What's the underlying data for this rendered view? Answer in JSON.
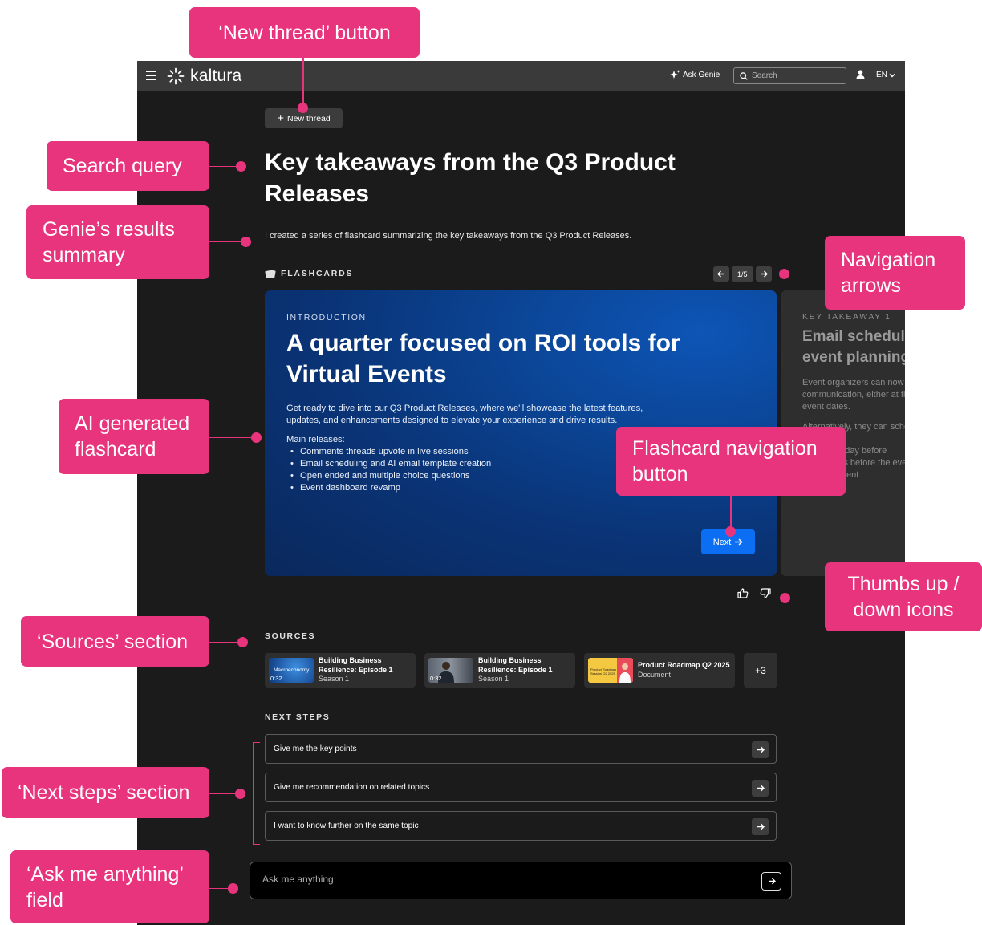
{
  "header": {
    "logo_text": "kaltura",
    "ask_genie_label": "Ask Genie",
    "search_placeholder": "Search",
    "language": "EN"
  },
  "thread": {
    "new_thread_label": "New thread",
    "query_title": "Key takeaways from the Q3 Product Releases",
    "summary": "I created a series of flashcard summarizing the key takeaways from the Q3 Product Releases."
  },
  "flashcards": {
    "section_label": "FLASHCARDS",
    "page_indicator": "1/5",
    "current": {
      "kicker": "INTRODUCTION",
      "title": "A quarter focused on ROI tools for Virtual Events",
      "intro": "Get ready to dive into our Q3 Product Releases, where we'll showcase the latest features, updates, and enhancements designed to elevate your experience and drive results.",
      "list_heading": "Main releases:",
      "items": [
        "Comments threads upvote in live sessions",
        "Email scheduling and AI email template creation",
        "Open ended and multiple choice questions",
        "Event dashboard revamp"
      ],
      "next_label": "Next"
    },
    "peek": {
      "kicker": "KEY TAKEAWAY 1",
      "title": "Email scheduling as part of event planning",
      "para1": "Event organizers can now schedule email communication, either at fixed times or relative to event dates.",
      "para2": "Alternatively, they can schedule at designated times such as:",
      "line1": "an hour or day before",
      "line2": "a few hours before the event",
      "line3": "after the event"
    }
  },
  "sources": {
    "label": "SOURCES",
    "items": [
      {
        "title": "Building Business Resilience: Episode 1",
        "subtitle": "Season 1",
        "duration": "0:32",
        "thumb_tag": "Macroeconomy"
      },
      {
        "title": "Building Business Resilience: Episode 1",
        "subtitle": "Season 1",
        "duration": "0:32"
      },
      {
        "title": "Product Roadmap Q2 2025",
        "subtitle": "Document",
        "thumb_tag": "Product Roadmap Session Q2 2025"
      }
    ],
    "more_label": "+3"
  },
  "next_steps": {
    "label": "NEXT STEPS",
    "items": [
      "Give me the key points",
      "Give me recommendation on related topics",
      "I want to know further on the same topic"
    ]
  },
  "ask": {
    "placeholder": "Ask me anything"
  },
  "annotations": {
    "new_thread": "‘New thread’ button",
    "search_query": "Search query",
    "results_summary": "Genie’s results summary",
    "navigation_arrows": "Navigation arrows",
    "ai_flashcard": "AI generated flashcard",
    "flashcard_nav": "Flashcard navigation button",
    "thumbs": "Thumbs up / down icons",
    "sources": "‘Sources’ section",
    "next_steps": "‘Next steps’ section",
    "ask_field": "‘Ask me anything’ field"
  },
  "colors": {
    "annotation": "#e8337d",
    "app_bg": "#1b1b1b",
    "topbar": "#3a3a3a",
    "next_button": "#0c6ef2",
    "card_gradient": "#0a3477"
  }
}
